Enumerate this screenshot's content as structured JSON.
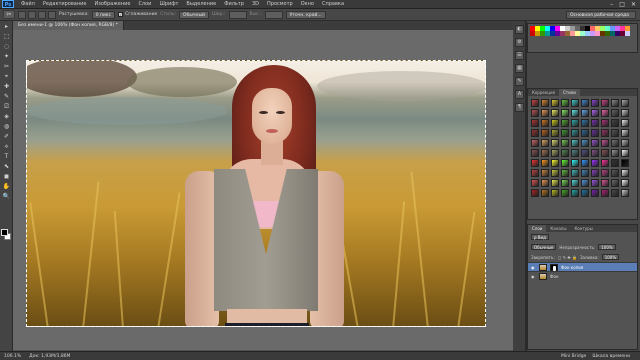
{
  "app": {
    "logo": "Ps",
    "menu": [
      "Файл",
      "Редактирование",
      "Изображение",
      "Слои",
      "Шрифт",
      "Выделение",
      "Фильтр",
      "3D",
      "Просмотр",
      "Окно",
      "Справка"
    ],
    "window_controls": [
      "–",
      "□",
      "✕"
    ]
  },
  "options": {
    "tool": "✂",
    "feather_label": "Растушевка:",
    "feather_value": "0 пикс",
    "smooth_label": "Сглаживание",
    "style_label": "Стиль:",
    "style_value": "Обычный",
    "width_label": "Шир.:",
    "height_label": "Выс.:",
    "refine_label": "Уточн. край...",
    "workspace": "Основная рабочая среда"
  },
  "document": {
    "tab_title": "Без имени-1 @ 106% (Фон копия, RGB/8) *"
  },
  "toolbox": {
    "tools": [
      "▸",
      "⬚",
      "◌",
      "✦",
      "✂",
      "⌖",
      "✚",
      "✎",
      "⎚",
      "◈",
      "◍",
      "✐",
      "⟡",
      "T",
      "⬉",
      "◼",
      "✋",
      "🔍"
    ]
  },
  "right_panel": {
    "dock_icons": [
      "◐",
      "⚙",
      "☰",
      "▦",
      "✎",
      "A",
      "¶"
    ],
    "swatches_colors": [
      "#ff0000",
      "#ffff00",
      "#00ff00",
      "#00ffff",
      "#0000ff",
      "#ff00ff",
      "#ffffff",
      "#cccccc",
      "#999999",
      "#666666",
      "#333333",
      "#000000",
      "#ff6666",
      "#ffcc66",
      "#99ff66",
      "#66ffcc",
      "#6699ff",
      "#cc66ff",
      "#ff3399",
      "#ff9933",
      "#cc0000",
      "#cc9900",
      "#339900",
      "#009999",
      "#003399",
      "#660099",
      "#993366",
      "#996633",
      "#ff9999",
      "#ffff99",
      "#99ffcc",
      "#99ccff",
      "#cc99ff",
      "#ff99cc",
      "#663300",
      "#336600",
      "#006666",
      "#330066",
      "#660033",
      "#ccccff"
    ],
    "styles_tabs": [
      "Коррекция",
      "Стили"
    ],
    "styles_colors": [
      "#c44",
      "#d83",
      "#dc3",
      "#6c4",
      "#4cc",
      "#48c",
      "#84c",
      "#c48",
      "#888",
      "#aaa",
      "#b55",
      "#e95",
      "#ee6",
      "#8e6",
      "#6ee",
      "#6ae",
      "#a6e",
      "#e6a",
      "#666",
      "#ccc",
      "#a33",
      "#c72",
      "#cc2",
      "#5a3",
      "#3aa",
      "#37a",
      "#73a",
      "#a37",
      "#444",
      "#eee",
      "#933",
      "#b62",
      "#aa3",
      "#493",
      "#399",
      "#369",
      "#639",
      "#936",
      "#555",
      "#ddd",
      "#c66",
      "#da6",
      "#dd7",
      "#7c5",
      "#5cc",
      "#59c",
      "#95c",
      "#c59",
      "#777",
      "#bbb",
      "#855",
      "#a75",
      "#aa6",
      "#585",
      "#588",
      "#558",
      "#858",
      "#855",
      "#999",
      "#fff",
      "#e33",
      "#f92",
      "#ff3",
      "#6f3",
      "#3ff",
      "#39f",
      "#93f",
      "#f39",
      "#333",
      "#000",
      "#b44",
      "#c84",
      "#cc4",
      "#6b4",
      "#4bb",
      "#48b",
      "#84b",
      "#b48",
      "#5a5a5a",
      "#efefef",
      "#d55",
      "#e95",
      "#ee5",
      "#7d5",
      "#5dd",
      "#59d",
      "#95d",
      "#d59",
      "#6a6a6a",
      "#fafafa",
      "#a22",
      "#b72",
      "#bb2",
      "#4a2",
      "#2aa",
      "#27a",
      "#72a",
      "#a27",
      "#4a4a4a",
      "#cfcfcf"
    ],
    "layers_tabs": [
      "Слои",
      "Каналы",
      "Контуры"
    ],
    "kind_label": "ρ Вид",
    "blend_mode": "Обычные",
    "opacity_label": "Непрозрачность:",
    "opacity_value": "100%",
    "lock_label": "Закрепить:",
    "fill_label": "Заливка:",
    "fill_value": "100%",
    "layers": [
      {
        "name": "Фон копия",
        "selected": true
      },
      {
        "name": "Фон",
        "selected": false
      }
    ]
  },
  "status": {
    "zoom": "106.1%",
    "doc": "Док: 1,93М/3,86М",
    "bottom_tabs": [
      "Mini Bridge",
      "Шкала времени"
    ]
  },
  "colors": {
    "accent": "#5a7eb5",
    "ui_bg": "#535353",
    "menu_bg": "#3a3a3a"
  }
}
